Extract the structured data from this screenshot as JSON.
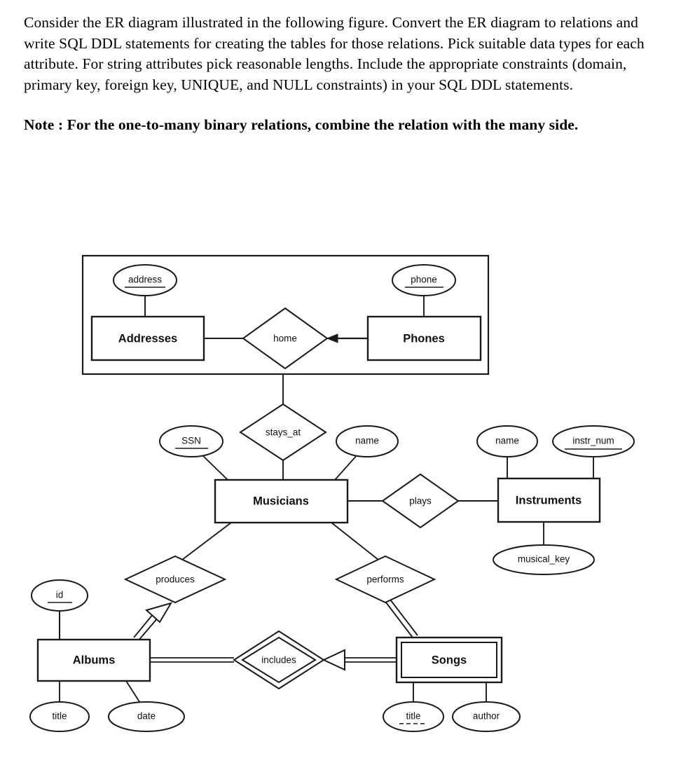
{
  "prompt": {
    "paragraph1": "Consider the ER diagram illustrated in the following figure. Convert the ER diagram to relations and write SQL DDL statements for creating the tables for those relations. Pick suitable data types for each attribute. For string attributes pick reasonable lengths. Include the appropriate constraints (domain, primary key, foreign key, UNIQUE, and NULL constraints) in your SQL DDL statements.",
    "note": "Note : For the one-to-many binary relations, combine the relation with the many side."
  },
  "diagram": {
    "type": "er-diagram",
    "entities": [
      {
        "id": "addresses",
        "label": "Addresses",
        "weak": false
      },
      {
        "id": "phones",
        "label": "Phones",
        "weak": false
      },
      {
        "id": "musicians",
        "label": "Musicians",
        "weak": false
      },
      {
        "id": "instruments",
        "label": "Instruments",
        "weak": false
      },
      {
        "id": "albums",
        "label": "Albums",
        "weak": false
      },
      {
        "id": "songs",
        "label": "Songs",
        "weak": true
      }
    ],
    "relationships": [
      {
        "id": "home",
        "label": "home",
        "identifying": false
      },
      {
        "id": "stays_at",
        "label": "stays_at",
        "identifying": false
      },
      {
        "id": "plays",
        "label": "plays",
        "identifying": false
      },
      {
        "id": "produces",
        "label": "produces",
        "identifying": false
      },
      {
        "id": "performs",
        "label": "performs",
        "identifying": false
      },
      {
        "id": "includes",
        "label": "includes",
        "identifying": true
      }
    ],
    "attributes": [
      {
        "id": "address",
        "label": "address",
        "owner": "addresses",
        "key": "primary"
      },
      {
        "id": "phone",
        "label": "phone",
        "owner": "phones",
        "key": "primary"
      },
      {
        "id": "ssn",
        "label": "SSN",
        "owner": "musicians",
        "key": "primary"
      },
      {
        "id": "mus_name",
        "label": "name",
        "owner": "musicians",
        "key": "none"
      },
      {
        "id": "instr_name",
        "label": "name",
        "owner": "instruments",
        "key": "none"
      },
      {
        "id": "instr_num",
        "label": "instr_num",
        "owner": "instruments",
        "key": "primary"
      },
      {
        "id": "musical_key",
        "label": "musical_key",
        "owner": "instruments",
        "key": "none"
      },
      {
        "id": "album_id",
        "label": "id",
        "owner": "albums",
        "key": "primary"
      },
      {
        "id": "album_title",
        "label": "title",
        "owner": "albums",
        "key": "none"
      },
      {
        "id": "album_date",
        "label": "date",
        "owner": "albums",
        "key": "none"
      },
      {
        "id": "song_title",
        "label": "title",
        "owner": "songs",
        "key": "partial"
      },
      {
        "id": "song_author",
        "label": "author",
        "owner": "songs",
        "key": "none"
      }
    ],
    "grouping_box_label": ""
  },
  "colors": {
    "stroke": "#1a1a1a",
    "fill": "#ffffff",
    "text": "#111111",
    "page_background": "#ffffff"
  }
}
